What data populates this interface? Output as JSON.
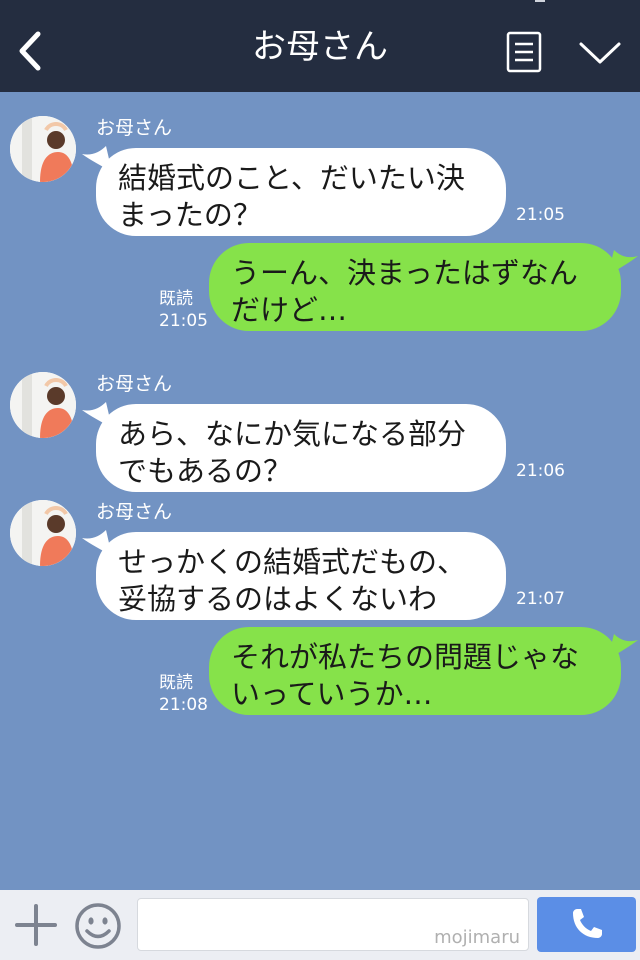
{
  "header": {
    "title": "お母さん",
    "back_icon": "chevron-left-icon",
    "menu_icon": "note-icon",
    "more_icon": "chevron-down-icon"
  },
  "messages": [
    {
      "type": "in",
      "sender": "お母さん",
      "lines": [
        "結婚式のこと、だいたい決",
        "まったの？"
      ],
      "time": "21:05"
    },
    {
      "type": "out",
      "read": "既読",
      "lines": [
        "うーん、決まったはずなん",
        "だけど…"
      ],
      "time": "21:05"
    },
    {
      "type": "in",
      "sender": "お母さん",
      "lines": [
        "あら、なにか気になる部分",
        "でもあるの？"
      ],
      "time": "21:06"
    },
    {
      "type": "in",
      "sender": "お母さん",
      "lines": [
        "せっかくの結婚式だもの、",
        "妥協するのはよくないわ"
      ],
      "time": "21:07"
    },
    {
      "type": "out",
      "read": "既読",
      "lines": [
        "それが私たちの問題じゃな",
        "いっていうか…"
      ],
      "time": "21:08"
    }
  ],
  "footer": {
    "input_placeholder": "mojimaru",
    "plus_icon": "plus-icon",
    "sticker_icon": "smiley-icon",
    "call_icon": "phone-icon"
  },
  "colors": {
    "header_bg": "#242d40",
    "chat_bg": "#7293c3",
    "incoming_bubble": "#ffffff",
    "outgoing_bubble": "#86e24a",
    "call_button": "#5b8ee6"
  }
}
